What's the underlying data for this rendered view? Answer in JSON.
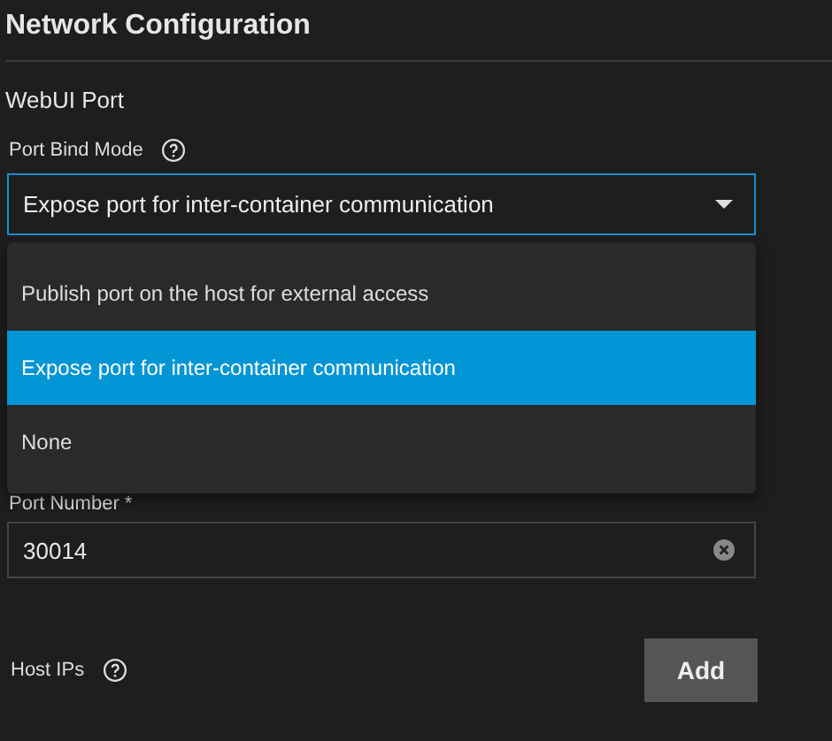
{
  "section_title": "Network Configuration",
  "group_title": "WebUI Port",
  "port_bind_mode": {
    "label": "Port Bind Mode",
    "value": "Expose port for inter-container communication",
    "expanded": true,
    "options": [
      {
        "label": "Publish port on the host for external access",
        "selected": false
      },
      {
        "label": "Expose port for inter-container communication",
        "selected": true
      },
      {
        "label": "None",
        "selected": false
      }
    ]
  },
  "port_number": {
    "label": "Port Number *",
    "value": "30014"
  },
  "host_ips": {
    "label": "Host IPs",
    "button": "Add"
  }
}
